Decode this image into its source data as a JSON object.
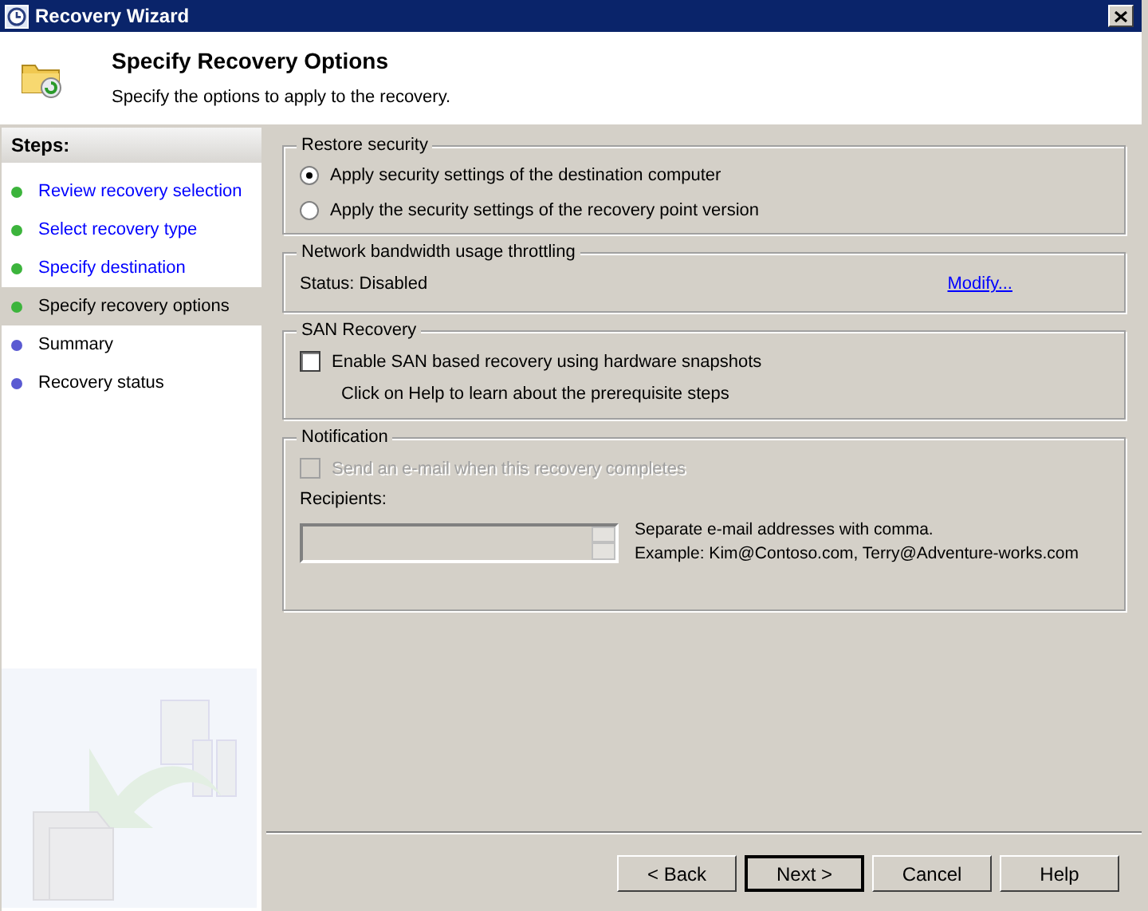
{
  "window": {
    "title": "Recovery Wizard"
  },
  "header": {
    "title": "Specify Recovery Options",
    "subtitle": "Specify the options to apply to the recovery."
  },
  "sidebar": {
    "title": "Steps:",
    "items": [
      {
        "label": "Review recovery selection",
        "color": "#3cb43c",
        "link": true,
        "selected": false
      },
      {
        "label": "Select recovery type",
        "color": "#3cb43c",
        "link": true,
        "selected": false
      },
      {
        "label": "Specify destination",
        "color": "#3cb43c",
        "link": true,
        "selected": false
      },
      {
        "label": "Specify recovery options",
        "color": "#3cb43c",
        "link": false,
        "selected": true
      },
      {
        "label": "Summary",
        "color": "#5a5ad2",
        "link": false,
        "selected": false
      },
      {
        "label": "Recovery status",
        "color": "#5a5ad2",
        "link": false,
        "selected": false
      }
    ]
  },
  "restore_security": {
    "title": "Restore security",
    "options": [
      {
        "label": "Apply security settings of the destination computer",
        "selected": true
      },
      {
        "label": "Apply the security settings of the recovery point version",
        "selected": false
      }
    ]
  },
  "throttling": {
    "title": "Network bandwidth usage throttling",
    "status": "Status: Disabled",
    "link": "Modify..."
  },
  "san_recovery": {
    "title": "SAN Recovery",
    "checkbox": {
      "label": "Enable SAN based recovery using hardware snapshots",
      "checked": false
    },
    "hint": "Click on Help to learn about the prerequisite steps"
  },
  "notification": {
    "title": "Notification",
    "checkbox": {
      "label": "Send an e-mail when this recovery completes",
      "checked": false,
      "disabled": true
    },
    "recipients_label": "Recipients:",
    "recipients_disabled": true,
    "help_lines": [
      "Separate e-mail addresses with comma.",
      "Example: Kim@Contoso.com, Terry@Adventure-works.com"
    ]
  },
  "buttons": [
    {
      "label": "< Back",
      "default": false
    },
    {
      "label": "Next >",
      "default": true
    },
    {
      "label": "Cancel",
      "default": false
    },
    {
      "label": "Help",
      "default": false
    }
  ]
}
